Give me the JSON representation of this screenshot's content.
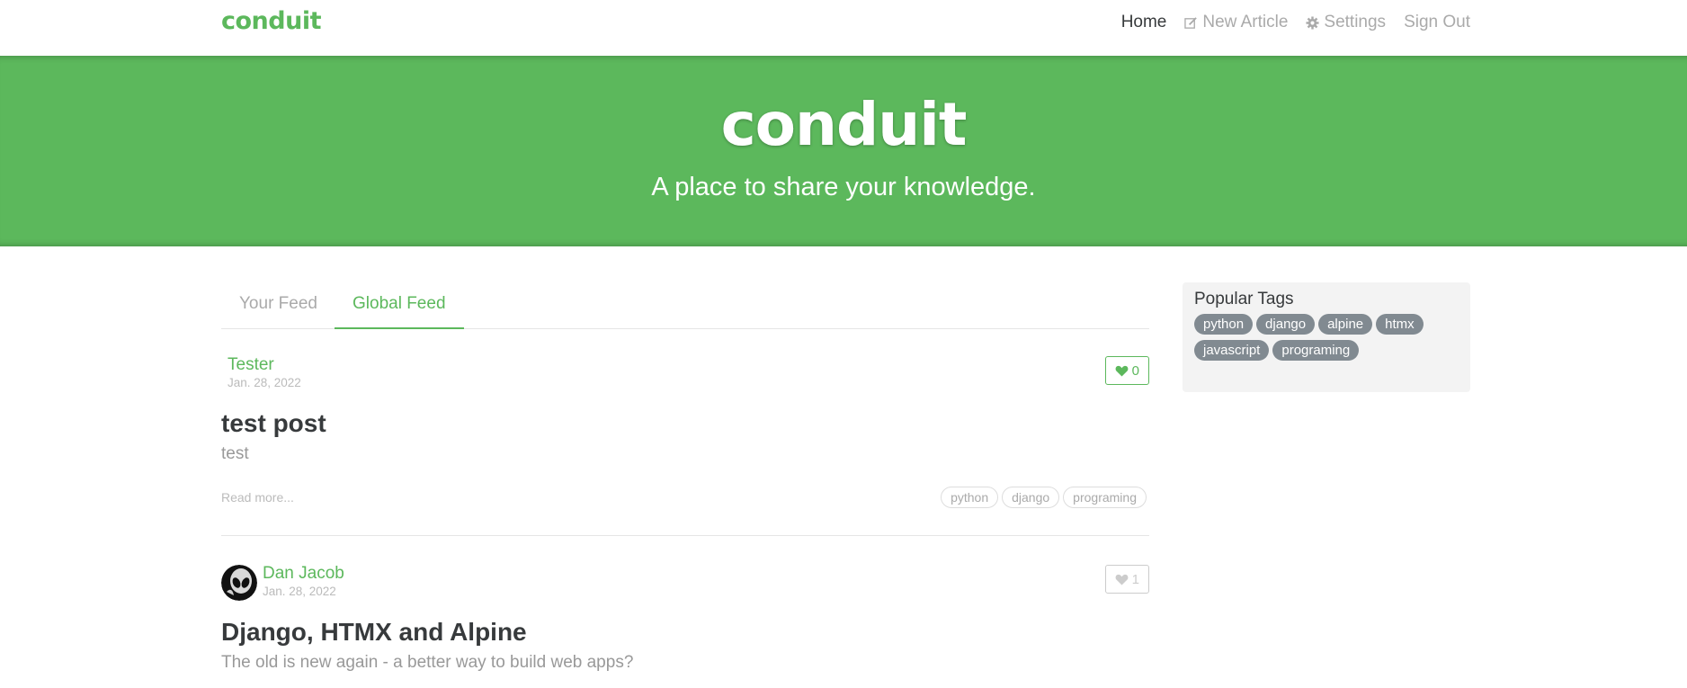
{
  "navbar": {
    "brand": "conduit",
    "items": [
      {
        "label": "Home",
        "icon": ""
      },
      {
        "label": "New Article",
        "icon": "compose-icon"
      },
      {
        "label": "Settings",
        "icon": "gear-icon"
      },
      {
        "label": "Sign Out",
        "icon": ""
      }
    ]
  },
  "banner": {
    "title": "conduit",
    "subtitle": "A place to share your knowledge."
  },
  "feed": {
    "tabs": [
      "Your Feed",
      "Global Feed"
    ],
    "active_tab": "Global Feed"
  },
  "articles": [
    {
      "author": "Tester",
      "date": "Jan. 28, 2022",
      "likes": "0",
      "title": "test post",
      "description": "test",
      "read_more": "Read more...",
      "tags": [
        "python",
        "django",
        "programing"
      ]
    },
    {
      "author": "Dan Jacob",
      "date": "Jan. 28, 2022",
      "likes": "1",
      "title": "Django, HTMX and Alpine",
      "description": "The old is new again - a better way to build web apps?"
    }
  ],
  "sidebar": {
    "title": "Popular Tags",
    "tags": [
      "python",
      "django",
      "alpine",
      "htmx",
      "javascript",
      "programing"
    ]
  },
  "colors": {
    "brand_green": "#5cb85c",
    "tag_grey": "#818a91",
    "muted_text": "#aaaaaa"
  }
}
